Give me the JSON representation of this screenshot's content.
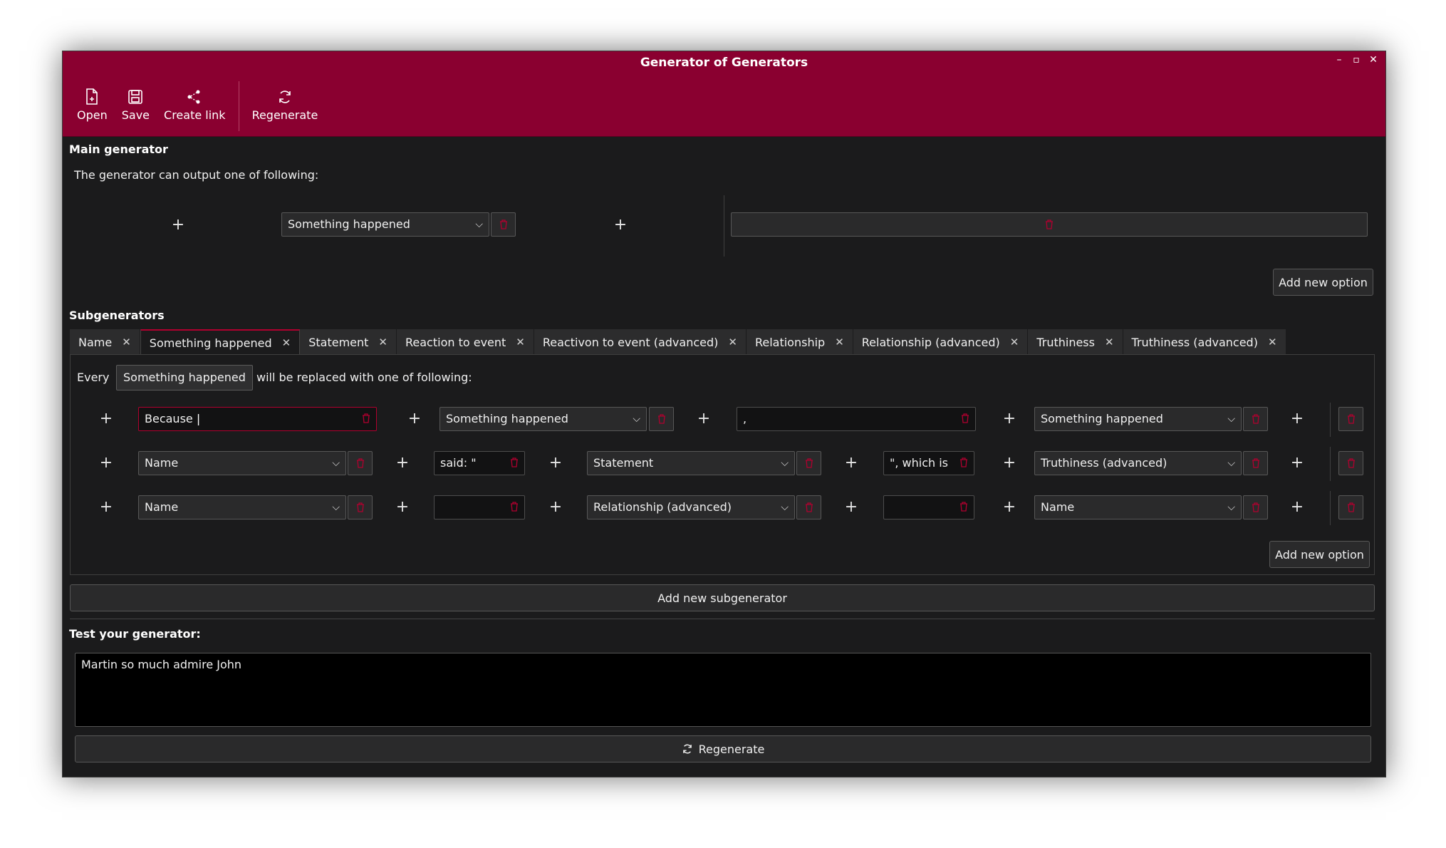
{
  "window": {
    "title": "Generator of Generators"
  },
  "toolbar": {
    "open": "Open",
    "save": "Save",
    "create_link": "Create link",
    "regenerate": "Regenerate"
  },
  "main": {
    "title": "Main generator",
    "description": "The generator can output one of following:",
    "option1_combo": "Something happened",
    "add_option": "Add new option"
  },
  "sub": {
    "title": "Subgenerators",
    "tabs": [
      "Name",
      "Something happened",
      "Statement",
      "Reaction to event",
      "Reactivon to event (advanced)",
      "Relationship",
      "Relationship (advanced)",
      "Truthiness",
      "Truthiness (advanced)"
    ],
    "active_tab": "Something happened",
    "every": "Every",
    "chip": "Something happened",
    "replaced": "will be replaced with one of following:",
    "rows": [
      {
        "a": "Because ",
        "b": "Something happened",
        "c": ",",
        "d": "Something happened"
      },
      {
        "a": "Name",
        "b": "said: \"",
        "c": "Statement",
        "d": "\", which is",
        "e": "Truthiness (advanced)"
      },
      {
        "a": "Name",
        "b": "",
        "c": "Relationship (advanced)",
        "d": "",
        "e": "Name"
      }
    ],
    "add_option": "Add new option",
    "add_subgenerator": "Add new subgenerator"
  },
  "test": {
    "title": "Test your generator:",
    "output": "Martin so much admire John",
    "regenerate": "Regenerate"
  },
  "colors": {
    "accent": "#8a0030",
    "trash": "#b0002f",
    "background": "#1b1b1c"
  }
}
